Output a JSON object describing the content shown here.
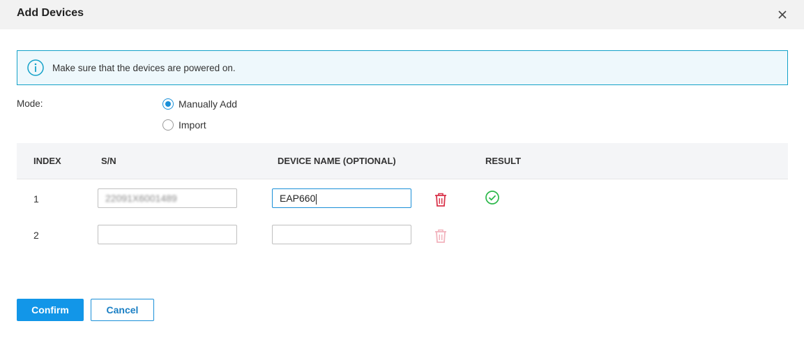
{
  "dialog": {
    "title": "Add Devices",
    "close_icon": "close-icon"
  },
  "info": {
    "icon": "info-icon",
    "text": "Make sure that the devices are powered on."
  },
  "mode": {
    "label": "Mode:",
    "options": [
      {
        "label": "Manually Add",
        "selected": true
      },
      {
        "label": "Import",
        "selected": false
      }
    ]
  },
  "table": {
    "headers": [
      "INDEX",
      "S/N",
      "DEVICE NAME (OPTIONAL)",
      "RESULT"
    ],
    "rows": [
      {
        "index": "1",
        "sn": "22091X6001489",
        "device_name": "EAP660",
        "result_icon": "check-circle-icon"
      },
      {
        "index": "2",
        "sn": "",
        "device_name": "",
        "result_icon": ""
      }
    ]
  },
  "actions": {
    "confirm_label": "Confirm",
    "cancel_label": "Cancel"
  },
  "colors": {
    "accent": "#1296e8",
    "info_border": "#13a1c8",
    "delete": "#d9334a",
    "delete_disabled": "#f2b3bd",
    "success": "#2db84b"
  }
}
